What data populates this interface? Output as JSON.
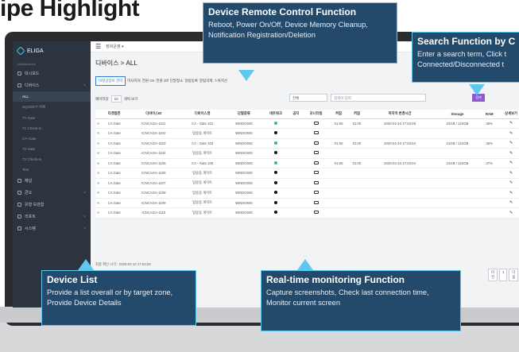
{
  "heading": "ipe Highlight",
  "app": {
    "logo": "ELIGA",
    "top_menu": "장비운영 ▾",
    "breadcrumb": "디바이스 > ALL"
  },
  "sidebar": {
    "section_label": "Maintenance",
    "items": [
      {
        "label": "대시보드"
      },
      {
        "label": "디바이스"
      }
    ],
    "sub_items": [
      "ALL",
      "SQISOFT 카페",
      "T1 Gate",
      "T1 Check-In",
      "CA-Gate",
      "T2 Gate",
      "T2 Check-In",
      "Test"
    ],
    "bottom_items": [
      "채널",
      "콘오",
      "유형 보관함",
      "리포트",
      "시스템"
    ]
  },
  "toolbar": {
    "status_tabs": [
      "비정상장비 관리",
      "마사지처",
      "전원 On",
      "전원 Off",
      "단말청소",
      "알림등록",
      "알림삭제",
      "스위치산"
    ],
    "page_size_label": "페이지당",
    "page_size_value": "10",
    "page_size_suffix": "개씩 보기",
    "filter_select": "전체",
    "search_placeholder": "검색어 입력",
    "search_button": "검색"
  },
  "table": {
    "columns": [
      "",
      "타겟팜존",
      "디바이스ID",
      "디바이스명",
      "단말종류",
      "네트워크",
      "공지",
      "모니터링",
      "켜짐",
      "꺼짐",
      "마지막 변경시간",
      "Storage",
      "RAM",
      "상세보기"
    ],
    "rows": [
      {
        "zone": "CA Gate",
        "id": "ICNCAGA-1101",
        "name": "CA - Gate 101",
        "type": "WINDOWS",
        "net": "on",
        "mon": true,
        "on": "01:50",
        "off": "01:00",
        "time": "2020-02-10 17:53:08",
        "storage": "22GB / 122GB",
        "ram": "35%"
      },
      {
        "zone": "CA Gate",
        "id": "ICNCAGA-1102",
        "name": "탑승동 게이트",
        "type": "WINDOWS",
        "net": "off",
        "mon": true,
        "on": "",
        "off": "",
        "time": "",
        "storage": "",
        "ram": ""
      },
      {
        "zone": "CA Gate",
        "id": "ICNCAGA-1103",
        "name": "CA - Gate 103",
        "type": "WINDOWS",
        "net": "on",
        "mon": true,
        "on": "01:50",
        "off": "01:00",
        "time": "2020-02-10 17:53:04",
        "storage": "21GB / 122GB",
        "ram": "36%"
      },
      {
        "zone": "CA Gate",
        "id": "ICNCAGA-1104",
        "name": "탑승동 게이트",
        "type": "WINDOWS",
        "net": "off",
        "mon": true,
        "on": "",
        "off": "",
        "time": "",
        "storage": "",
        "ram": ""
      },
      {
        "zone": "CA Gate",
        "id": "ICNCAGA-1105",
        "name": "CA - Gate 105",
        "type": "WINDOWS",
        "net": "on",
        "mon": true,
        "on": "01:50",
        "off": "01:00",
        "time": "2020-02-10 17:53:04",
        "storage": "21GB / 122GB",
        "ram": "37%"
      },
      {
        "zone": "CA Gate",
        "id": "ICNCAGA-1106",
        "name": "탑승동 게이트",
        "type": "WINDOWS",
        "net": "off",
        "mon": true,
        "on": "",
        "off": "",
        "time": "",
        "storage": "",
        "ram": ""
      },
      {
        "zone": "CA Gate",
        "id": "ICNCAGA-1107",
        "name": "탑승동 게이트",
        "type": "WINDOWS",
        "net": "off",
        "mon": true,
        "on": "",
        "off": "",
        "time": "",
        "storage": "",
        "ram": ""
      },
      {
        "zone": "CA Gate",
        "id": "ICNCAGA-1108",
        "name": "탑승동 게이트",
        "type": "WINDOWS",
        "net": "off",
        "mon": true,
        "on": "",
        "off": "",
        "time": "",
        "storage": "",
        "ram": ""
      },
      {
        "zone": "CA Gate",
        "id": "ICNCAGA-1109",
        "name": "탑승동 게이트",
        "type": "WINDOWS",
        "net": "off",
        "mon": true,
        "on": "",
        "off": "",
        "time": "",
        "storage": "",
        "ram": ""
      },
      {
        "zone": "CA Gate",
        "id": "ICNCAGA-1110",
        "name": "탑승동 게이트",
        "type": "WINDOWS",
        "net": "off",
        "mon": true,
        "on": "",
        "off": "",
        "time": "",
        "storage": "",
        "ram": ""
      }
    ],
    "last_update": "최종 확인 시각 : 2020-02-10 17:53:29"
  },
  "pager": [
    "이전",
    "1",
    "다음",
    "끝"
  ],
  "callouts": {
    "remote": {
      "title": "Device Remote Control Function",
      "body1": "Reboot, Power On/Off, Device Memory Cleanup,",
      "body2": "Notification Registration/Deletion"
    },
    "search": {
      "title": "Search Function by C",
      "body1": "Enter a search term, Click t",
      "body2": "Connected/Disconnected t"
    },
    "device_list": {
      "title": "Device List",
      "body1": "Provide a list overall or by target zone,",
      "body2": "Provide Device Details"
    },
    "monitoring": {
      "title": "Real-time monitoring Function",
      "body1": "Capture screenshots, Check last connection time,",
      "body2": "Monitor current screen"
    }
  },
  "colors": {
    "accent": "#5ec8f0",
    "callout_bg": "#234a6b",
    "sidebar": "#2c3440",
    "search_btn": "#8c5bd0",
    "online": "#2fbf74"
  }
}
